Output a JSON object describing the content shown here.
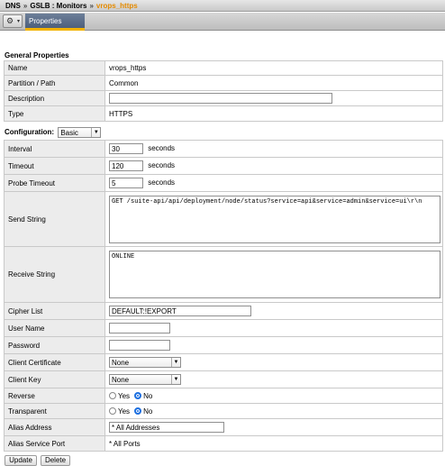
{
  "breadcrumb": {
    "part1": "DNS",
    "sep1": "»",
    "part2": "GSLB : Monitors",
    "sep2": "»",
    "current": "vrops_https"
  },
  "tabs": {
    "gear_icon": "gear-icon",
    "gear_glyph": "⚙",
    "caret": "▾",
    "properties": "Properties"
  },
  "general": {
    "heading": "General Properties",
    "name_label": "Name",
    "name_value": "vrops_https",
    "partition_label": "Partition / Path",
    "partition_value": "Common",
    "description_label": "Description",
    "description_value": "",
    "type_label": "Type",
    "type_value": "HTTPS"
  },
  "configuration": {
    "label": "Configuration:",
    "mode": "Basic",
    "interval_label": "Interval",
    "interval_value": "30",
    "interval_unit": "seconds",
    "timeout_label": "Timeout",
    "timeout_value": "120",
    "timeout_unit": "seconds",
    "probe_timeout_label": "Probe Timeout",
    "probe_timeout_value": "5",
    "probe_timeout_unit": "seconds",
    "send_string_label": "Send String",
    "send_string_value": "GET /suite-api/api/deployment/node/status?service=api&service=admin&service=ui\\r\\n",
    "receive_string_label": "Receive String",
    "receive_string_value": "ONLINE",
    "cipher_list_label": "Cipher List",
    "cipher_list_value": "DEFAULT:!EXPORT",
    "user_name_label": "User Name",
    "user_name_value": "",
    "password_label": "Password",
    "password_value": "",
    "client_cert_label": "Client Certificate",
    "client_cert_value": "None",
    "client_key_label": "Client Key",
    "client_key_value": "None",
    "reverse_label": "Reverse",
    "reverse_yes": "Yes",
    "reverse_no": "No",
    "reverse_selected": "No",
    "transparent_label": "Transparent",
    "transparent_yes": "Yes",
    "transparent_no": "No",
    "transparent_selected": "No",
    "alias_address_label": "Alias Address",
    "alias_address_value": "* All Addresses",
    "alias_port_label": "Alias Service Port",
    "alias_port_value": "* All Ports"
  },
  "buttons": {
    "update": "Update",
    "delete": "Delete"
  },
  "colors": {
    "tab_active": "#5a6c88",
    "tab_underline": "#f2b200",
    "breadcrumb_current": "#e58b00",
    "radio_selected": "#1c6fe0",
    "label_cell_bg": "#ececec"
  }
}
